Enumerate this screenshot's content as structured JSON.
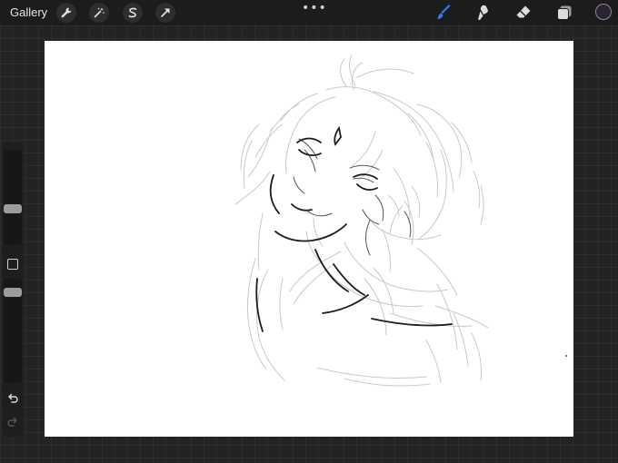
{
  "toolbar": {
    "gallery_label": "Gallery",
    "left_tools": [
      "wrench-icon",
      "magic-wand-icon",
      "selection-s-icon",
      "transform-arrow-icon"
    ],
    "center_menu": "•••",
    "right_tools": [
      "brush-icon",
      "smudge-icon",
      "eraser-icon",
      "layers-icon"
    ],
    "active_tool": "brush",
    "active_color": "#2a2434",
    "accent_color": "#2f7df6"
  },
  "sidebar": {
    "brush_size_level": 0.45,
    "opacity_level": 0.55,
    "controls": [
      "brush-size-slider",
      "modify-button",
      "opacity-slider",
      "undo-icon",
      "redo-icon"
    ]
  },
  "canvas": {
    "content": "sketch"
  }
}
